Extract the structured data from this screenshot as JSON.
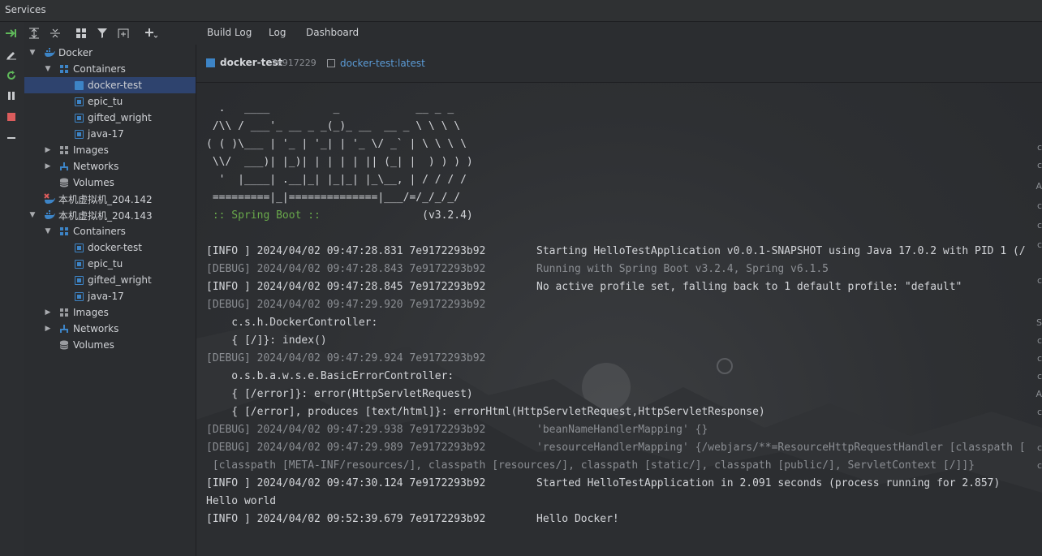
{
  "title": "Services",
  "tabs": [
    "Build Log",
    "Log",
    "Dashboard"
  ],
  "active_tab": "Log",
  "context": {
    "container_name": "docker-test",
    "container_id": "7e917229",
    "image_name": "docker-test:latest"
  },
  "tree": [
    {
      "label": "Docker"
    },
    {
      "label": "Containers"
    },
    {
      "label": "docker-test"
    },
    {
      "label": "epic_tu"
    },
    {
      "label": "gifted_wright"
    },
    {
      "label": "java-17"
    },
    {
      "label": "Images"
    },
    {
      "label": "Networks"
    },
    {
      "label": "Volumes"
    },
    {
      "label": "本机虚拟机_204.142"
    },
    {
      "label": "本机虚拟机_204.143"
    },
    {
      "label": "Containers"
    },
    {
      "label": "docker-test"
    },
    {
      "label": "epic_tu"
    },
    {
      "label": "gifted_wright"
    },
    {
      "label": "java-17"
    },
    {
      "label": "Images"
    },
    {
      "label": "Networks"
    },
    {
      "label": "Volumes"
    }
  ],
  "log": {
    "banner": [
      "  .   ____          _            __ _ _",
      " /\\\\ / ___'_ __ _ _(_)_ __  __ _ \\ \\ \\ \\",
      "( ( )\\___ | '_ | '_| | '_ \\/ _` | \\ \\ \\ \\",
      " \\\\/  ___)| |_)| | | | | || (_| |  ) ) ) )",
      "  '  |____| .__|_| |_|_| |_\\__, | / / / /",
      " =========|_|==============|___/=/_/_/_/"
    ],
    "spring_label": " :: Spring Boot :: ",
    "spring_version": "               (v3.2.4)",
    "l1": "[INFO ] 2024/04/02 09:47:28.831 7e9172293b92        Starting HelloTestApplication v0.0.1-SNAPSHOT using Java 17.0.2 with PID 1 (/",
    "l2": "[DEBUG] 2024/04/02 09:47:28.843 7e9172293b92        Running with Spring Boot v3.2.4, Spring v6.1.5",
    "l3": "[INFO ] 2024/04/02 09:47:28.845 7e9172293b92        No active profile set, falling back to 1 default profile: \"default\"",
    "l4": "[DEBUG] 2024/04/02 09:47:29.920 7e9172293b92",
    "l5": "    c.s.h.DockerController:",
    "l6": "    { [/]}: index()",
    "l7": "[DEBUG] 2024/04/02 09:47:29.924 7e9172293b92",
    "l8": "    o.s.b.a.w.s.e.BasicErrorController:",
    "l9": "    { [/error]}: error(HttpServletRequest)",
    "l10": "    { [/error], produces [text/html]}: errorHtml(HttpServletRequest,HttpServletResponse)",
    "l11": "[DEBUG] 2024/04/02 09:47:29.938 7e9172293b92        'beanNameHandlerMapping' {}",
    "l12": "[DEBUG] 2024/04/02 09:47:29.989 7e9172293b92        'resourceHandlerMapping' {/webjars/**=ResourceHttpRequestHandler [classpath [",
    "l13": " [classpath [META-INF/resources/], classpath [resources/], classpath [static/], classpath [public/], ServletContext [/]]}",
    "l14": "[INFO ] 2024/04/02 09:47:30.124 7e9172293b92        Started HelloTestApplication in 2.091 seconds (process running for 2.857)",
    "l15": "Hello world",
    "l16": "[INFO ] 2024/04/02 09:52:39.679 7e9172293b92        Hello Docker!"
  },
  "right_edge": [
    "c",
    "c",
    "A",
    "c",
    "c",
    "c",
    "c",
    "S",
    "c",
    "c",
    "c",
    "A",
    "c",
    "c",
    "c"
  ],
  "colors": {
    "accent": "#3d84c6",
    "debug": "#8b8e93",
    "spring": "#69a94b"
  }
}
